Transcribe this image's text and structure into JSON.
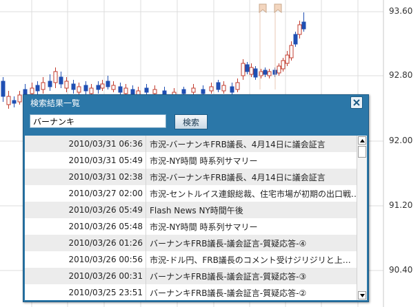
{
  "chart": {
    "price_labels": [
      "93.60",
      "92.80",
      "92.00",
      "91.20",
      "90.40"
    ]
  },
  "dialog": {
    "title": "検索結果一覧",
    "search_value": "バーナンキ",
    "search_button": "検索"
  },
  "results": [
    {
      "date": "2010/03/31 06:36",
      "title": "市況-バーナンキFRB議長、4月14日に議会証言"
    },
    {
      "date": "2010/03/31 05:49",
      "title": "市況-NY時間 時系列サマリー"
    },
    {
      "date": "2010/03/31 02:38",
      "title": "市況-バーナンキFRB議長、4月14日に議会証言"
    },
    {
      "date": "2010/03/27 02:00",
      "title": "市況-セントルイス連銀総裁、住宅市場が初期の出口戦…"
    },
    {
      "date": "2010/03/26 05:49",
      "title": "Flash News NY時間午後"
    },
    {
      "date": "2010/03/26 05:48",
      "title": "市況-NY時間 時系列サマリー"
    },
    {
      "date": "2010/03/26 01:26",
      "title": "バーナンキFRB議長-議会証言-質疑応答-④"
    },
    {
      "date": "2010/03/26 00:56",
      "title": "市況-ドル円、FRB議長のコメント受けジリジリと上…"
    },
    {
      "date": "2010/03/26 00:31",
      "title": "バーナンキFRB議長-議会証言-質疑応答-③"
    },
    {
      "date": "2010/03/25 23:51",
      "title": "バーナンキFRB議長-議会証言-質疑応答-②"
    }
  ]
}
